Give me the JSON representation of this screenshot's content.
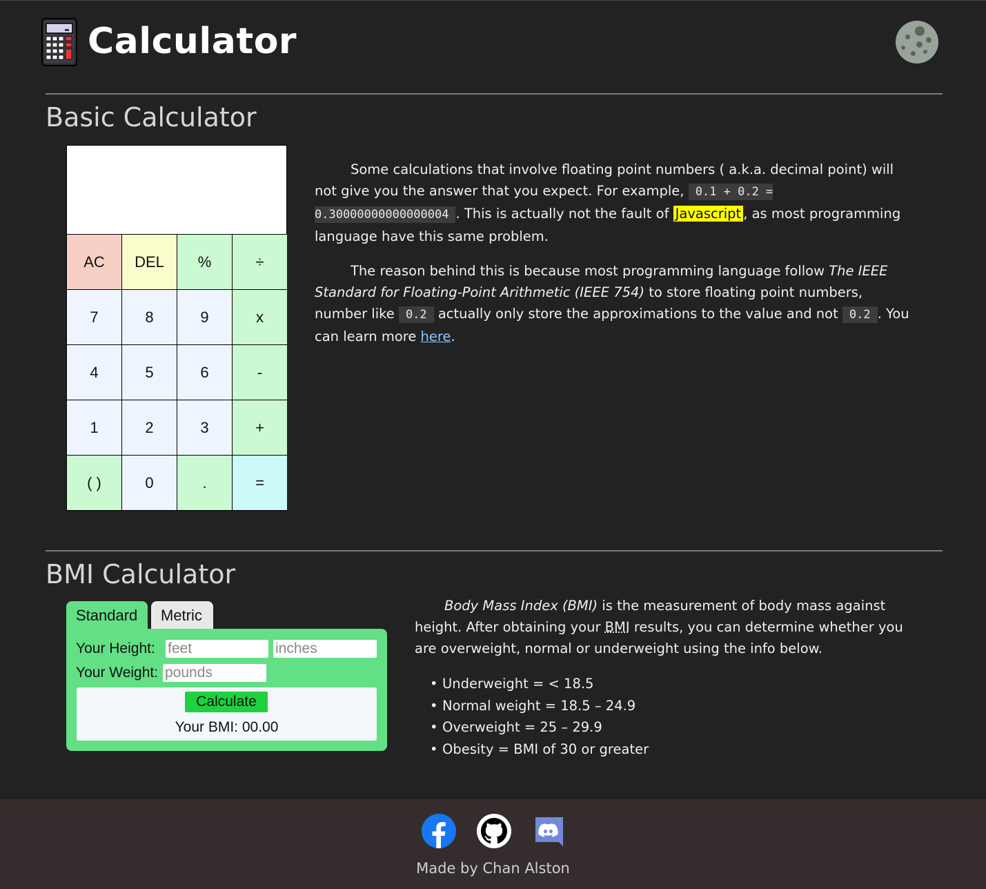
{
  "header": {
    "title": "Calculator",
    "theme_toggle": "moon-icon"
  },
  "basic": {
    "title": "Basic Calculator",
    "display": "",
    "buttons": [
      {
        "label": "AC",
        "kind": "ac"
      },
      {
        "label": "DEL",
        "kind": "del"
      },
      {
        "label": "%",
        "kind": "op"
      },
      {
        "label": "÷",
        "kind": "op"
      },
      {
        "label": "7",
        "kind": "num"
      },
      {
        "label": "8",
        "kind": "num"
      },
      {
        "label": "9",
        "kind": "num"
      },
      {
        "label": "x",
        "kind": "op"
      },
      {
        "label": "4",
        "kind": "num"
      },
      {
        "label": "5",
        "kind": "num"
      },
      {
        "label": "6",
        "kind": "num"
      },
      {
        "label": "-",
        "kind": "op"
      },
      {
        "label": "1",
        "kind": "num"
      },
      {
        "label": "2",
        "kind": "num"
      },
      {
        "label": "3",
        "kind": "num"
      },
      {
        "label": "+",
        "kind": "op"
      },
      {
        "label": "( )",
        "kind": "op"
      },
      {
        "label": "0",
        "kind": "num"
      },
      {
        "label": ".",
        "kind": "op"
      },
      {
        "label": "=",
        "kind": "eq"
      }
    ],
    "info": {
      "p1_a": "Some calculations that involve floating point numbers ( a.k.a. decimal point) will not give you the answer that you expect. For example,",
      "p1_code": "0.1 + 0.2 = 0.30000000000000004",
      "p1_b": ". This is actually not the fault of",
      "p1_hl": "Javascript",
      "p1_c": ", as most programming language have this same problem.",
      "p2_a": "The reason behind this is because most programming language follow",
      "p2_em": "The IEEE Standard for Floating-Point Arithmetic (IEEE 754)",
      "p2_b": "to store floating point numbers, number like",
      "p2_code1": "0.2",
      "p2_c": "actually only store the approximations to the value and not",
      "p2_code2": "0.2",
      "p2_d": ". You can learn more",
      "p2_link": "here",
      "p2_e": "."
    }
  },
  "bmi": {
    "title": "BMI Calculator",
    "tabs": {
      "standard": "Standard",
      "metric": "Metric"
    },
    "height_label": "Your Height:",
    "weight_label": "Your Weight:",
    "feet_placeholder": "feet",
    "inches_placeholder": "inches",
    "pounds_placeholder": "pounds",
    "calculate_label": "Calculate",
    "result": "Your BMI: 00.00",
    "info": {
      "em": "Body Mass Index (BMI)",
      "a": "is the measurement of body mass against height. After obtaining your",
      "abbr": "BMI",
      "b": "results, you can determine whether you are overweight, normal or underweight using the info below."
    },
    "categories": [
      "Underweight = < 18.5",
      "Normal weight = 18.5 – 24.9",
      "Overweight = 25 – 29.9",
      "Obesity = BMI of 30 or greater"
    ]
  },
  "footer": {
    "icons": [
      "facebook-icon",
      "github-icon",
      "discord-icon"
    ],
    "made_by": "Made by Chan Alston"
  },
  "colors": {
    "background": "#222222",
    "footer": "#352d2d",
    "bmi_green": "#63df85",
    "calculate_green": "#1fd13f",
    "highlight": "#ffff00",
    "link": "#8cc8ff"
  }
}
